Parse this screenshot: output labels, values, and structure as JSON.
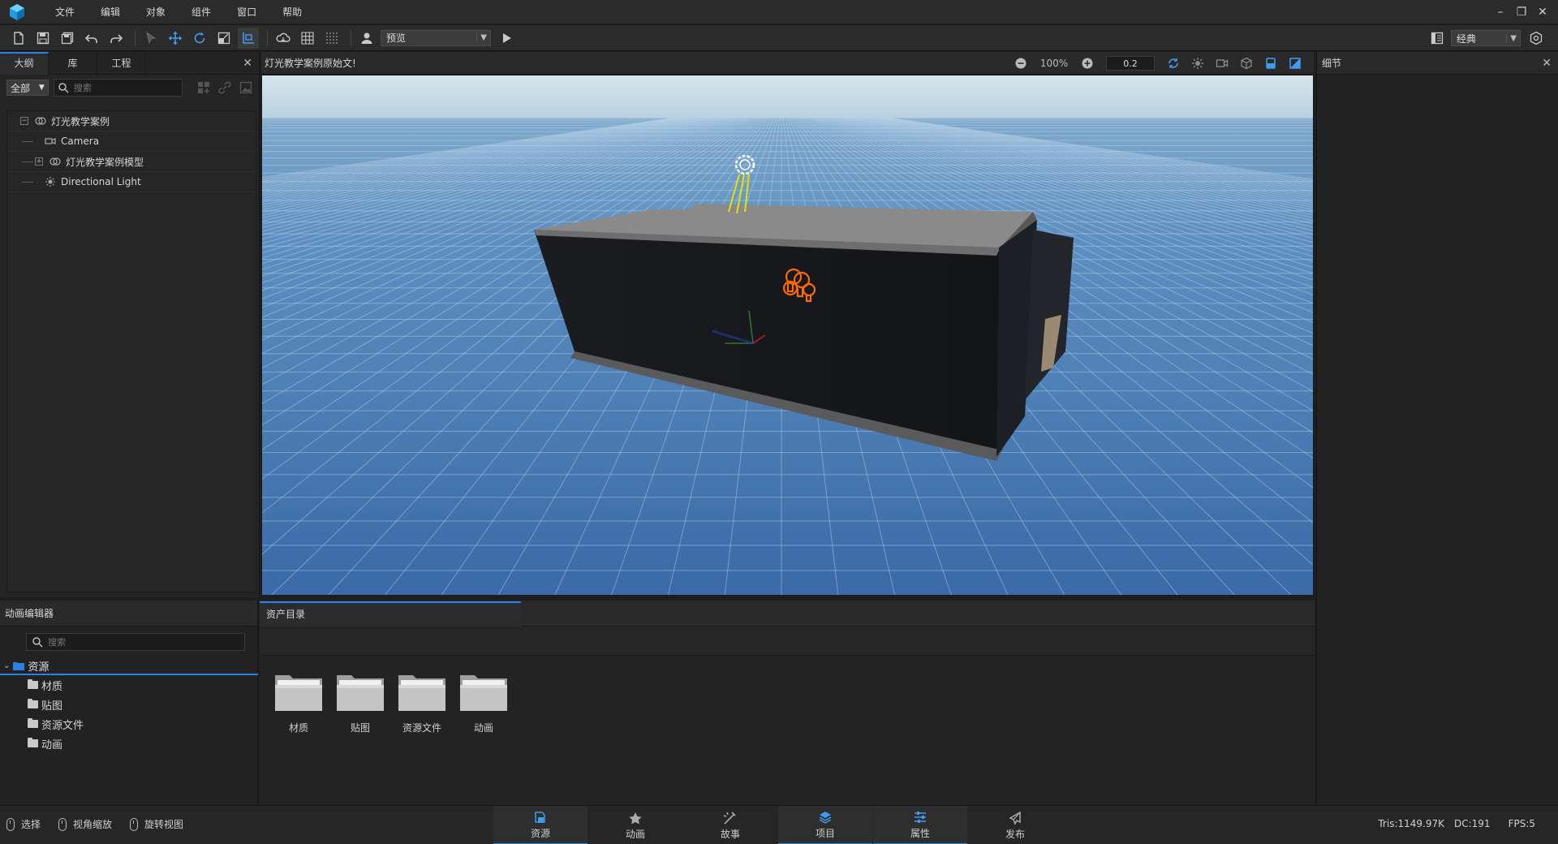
{
  "menu": {
    "items": [
      "文件",
      "编辑",
      "对象",
      "组件",
      "窗口",
      "帮助"
    ],
    "window_controls": {
      "minimize": "–",
      "restore": "❐",
      "close": "✕"
    }
  },
  "toolbar": {
    "preview_select": "预览",
    "layout_select": "经典",
    "icons": [
      "new-file-icon",
      "save-icon",
      "save-all-icon",
      "undo-icon",
      "redo-icon",
      "select-tool-icon",
      "move-tool-icon",
      "rotate-tool-icon",
      "scale-tool-icon",
      "pivot-tool-icon",
      "cloud-icon",
      "grid-icon",
      "dot-grid-icon",
      "avatar-icon",
      "play-icon"
    ]
  },
  "left_panel": {
    "tabs": [
      "大纲",
      "库",
      "工程"
    ],
    "filter_value": "全部",
    "search_placeholder": "搜索",
    "tree": [
      {
        "label": "灯光教学案例",
        "icon": "group-icon",
        "level": 0,
        "expander": "⊟"
      },
      {
        "label": "Camera",
        "icon": "camera-icon",
        "level": 1,
        "expander": ""
      },
      {
        "label": "灯光教学案例模型",
        "icon": "group-icon",
        "level": 1,
        "expander": "⊞"
      },
      {
        "label": "Directional Light",
        "icon": "sun-icon",
        "level": 1,
        "expander": ""
      }
    ]
  },
  "viewport": {
    "title": "灯光教学案例原始文!",
    "zoom": "100%",
    "snap_value": "0.2"
  },
  "right_panel": {
    "title": "细节"
  },
  "anim_panel": {
    "title": "动画编辑器",
    "search_placeholder": "搜索",
    "tree_root": "资源",
    "tree_items": [
      "材质",
      "贴图",
      "资源文件",
      "动画"
    ]
  },
  "asset_panel": {
    "tab": "资产目录",
    "folders": [
      "材质",
      "贴图",
      "资源文件",
      "动画"
    ]
  },
  "status": {
    "hints": [
      "选择",
      "视角缩放",
      "旋转视图"
    ],
    "bottom_tabs": [
      {
        "label": "资源",
        "icon": "resource-icon",
        "active": true
      },
      {
        "label": "动画",
        "icon": "animation-icon",
        "active": false
      },
      {
        "label": "故事",
        "icon": "story-icon",
        "active": false
      },
      {
        "label": "项目",
        "icon": "project-icon",
        "active": true
      },
      {
        "label": "属性",
        "icon": "properties-icon",
        "active": true
      },
      {
        "label": "发布",
        "icon": "publish-icon",
        "active": false
      }
    ],
    "tris": "Tris:1149.97K",
    "dc": "DC:191",
    "fps": "FPS:5"
  },
  "colors": {
    "accent": "#2a82e4",
    "light_gizmo": "#ff6a00",
    "sun_ray": "#e8e000"
  }
}
